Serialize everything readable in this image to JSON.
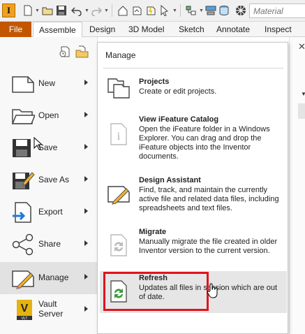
{
  "qat": {
    "app_logo": "I",
    "material_placeholder": "Material",
    "icons": [
      "new-icon",
      "open-icon",
      "save-icon",
      "undo-icon",
      "redo-icon",
      "home-icon",
      "return-icon",
      "update-icon",
      "select-icon",
      "parameters-icon",
      "appearance-icon"
    ]
  },
  "tabs": [
    {
      "label": "File"
    },
    {
      "label": "Assemble"
    },
    {
      "label": "Design"
    },
    {
      "label": "3D Model"
    },
    {
      "label": "Sketch"
    },
    {
      "label": "Annotate"
    },
    {
      "label": "Inspect"
    }
  ],
  "menu": [
    {
      "label": "New",
      "icon": "new-document-icon",
      "has_arrow": true
    },
    {
      "label": "Open",
      "icon": "folder-open-icon",
      "has_arrow": true
    },
    {
      "label": "Save",
      "icon": "save-disk-icon",
      "has_arrow": true
    },
    {
      "label": "Save As",
      "icon": "save-as-icon",
      "has_arrow": true
    },
    {
      "label": "Export",
      "icon": "export-icon",
      "has_arrow": true
    },
    {
      "label": "Share",
      "icon": "share-icon",
      "has_arrow": true
    },
    {
      "label": "Manage",
      "icon": "manage-icon",
      "has_arrow": true,
      "selected": true
    },
    {
      "label": "Vault Server",
      "icon": "vault-server-icon",
      "has_arrow": true
    }
  ],
  "flyout": {
    "title": "Manage",
    "items": [
      {
        "title": "Projects",
        "desc": "Create or edit projects.",
        "icon": "projects-icon"
      },
      {
        "title": "View iFeature Catalog",
        "desc": "Open the iFeature folder in a Windows Explorer. You can drag and drop the iFeature objects into the Inventor documents.",
        "icon": "ifeature-catalog-icon"
      },
      {
        "title": "Design Assistant",
        "desc": "Find, track, and maintain the currently active file and related data files, including spreadsheets and text files.",
        "icon": "design-assistant-icon"
      },
      {
        "title": "Migrate",
        "desc": "Manually migrate the file created in older Inventor version to the current version.",
        "icon": "migrate-icon"
      },
      {
        "title": "Refresh",
        "desc": "Updates all files in session which are out of date.",
        "icon": "refresh-icon"
      }
    ]
  },
  "colors": {
    "file_tab": "#c25700",
    "highlight": "#e0141e",
    "vault": "#e5b30f"
  }
}
